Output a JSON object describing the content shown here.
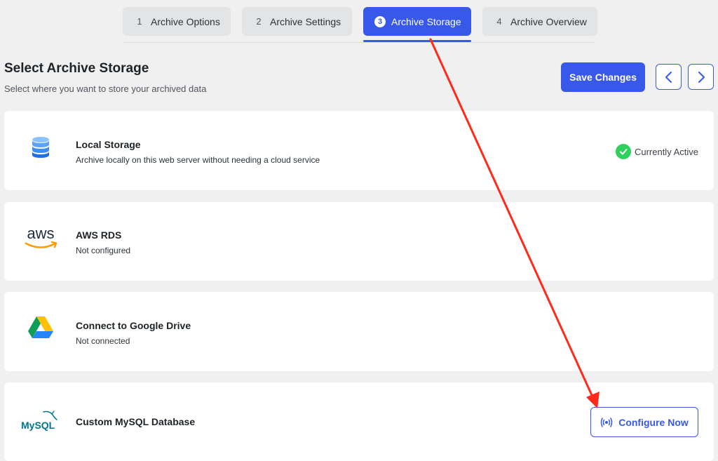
{
  "steps": [
    {
      "num": "1",
      "label": "Archive Options",
      "active": false
    },
    {
      "num": "2",
      "label": "Archive Settings",
      "active": false
    },
    {
      "num": "3",
      "label": "Archive Storage",
      "active": true
    },
    {
      "num": "4",
      "label": "Archive Overview",
      "active": false
    }
  ],
  "header": {
    "title": "Select Archive Storage",
    "subtitle": "Select where you want to store your archived data",
    "save_label": "Save Changes"
  },
  "storage_options": {
    "local": {
      "title": "Local Storage",
      "desc": "Archive locally on this web server without needing a cloud service",
      "status": "Currently Active"
    },
    "aws": {
      "logo_text": "aws",
      "title": "AWS RDS",
      "desc": "Not configured"
    },
    "gdrive": {
      "title": "Connect to Google Drive",
      "desc": "Not connected"
    },
    "mysql": {
      "logo_text": "MySQL",
      "title": "Custom MySQL Database",
      "action_label": "Configure Now"
    }
  },
  "colors": {
    "accent": "#3858e9",
    "success": "#2fd15c",
    "annotation": "#ff2a1a",
    "background": "#f0f0f1"
  },
  "icons": {
    "local": "database-icon",
    "aws": "aws-logo",
    "gdrive": "google-drive-logo",
    "mysql": "mysql-logo",
    "configure": "broadcast-icon",
    "status": "check-circle-icon",
    "prev": "chevron-left-icon",
    "next": "chevron-right-icon"
  }
}
